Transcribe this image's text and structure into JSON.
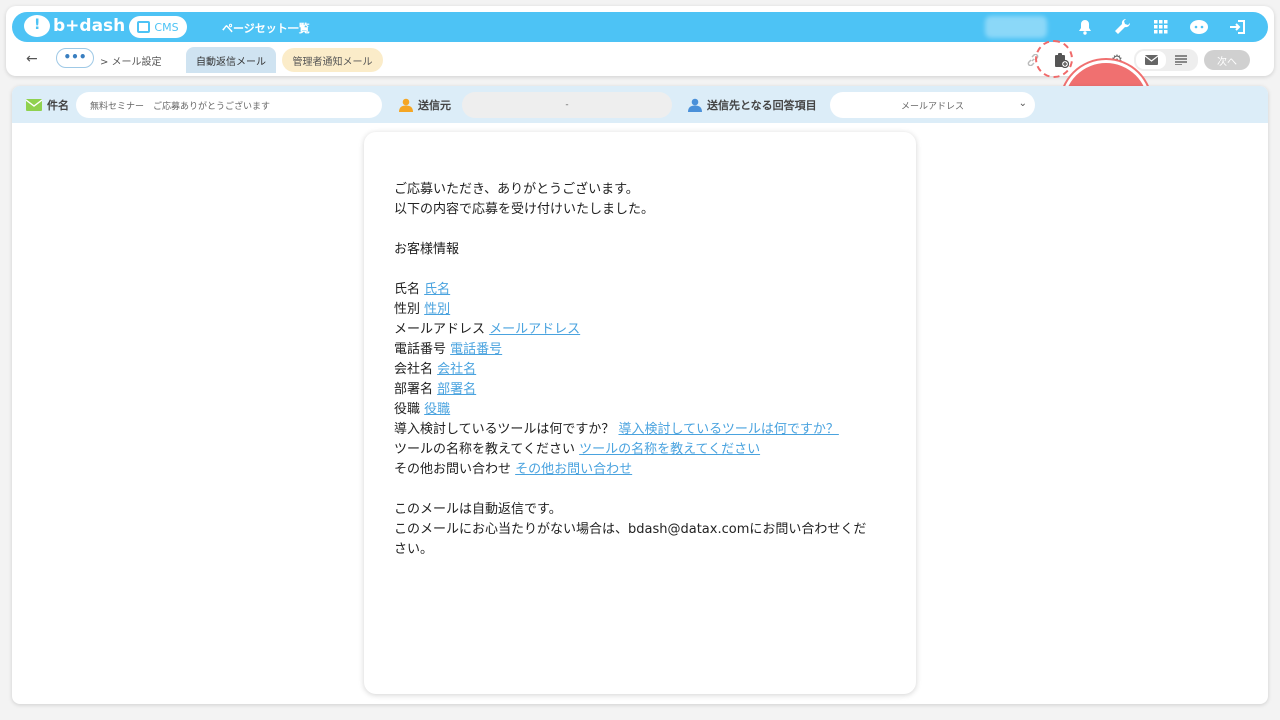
{
  "header": {
    "logo_text": "b+dash",
    "cms_label": "CMS",
    "page_title": "ページセット一覧",
    "brand_color": "#4dc3f5"
  },
  "subbar": {
    "dots_label": "•••",
    "breadcrumb": "> メール設定",
    "tabs": [
      {
        "label": "自動返信メール",
        "active": true
      },
      {
        "label": "管理者通知メール",
        "active": false
      }
    ],
    "next_label": "次へ"
  },
  "fields": {
    "subject_label": "件名",
    "subject_value": "無料セミナー　ご応募ありがとうございます",
    "sender_label": "送信元",
    "sender_value": "-",
    "recipient_label": "送信先となる回答項目",
    "recipient_value": "メールアドレス"
  },
  "mail": {
    "greeting_1": "ご応募いただき、ありがとうございます。",
    "greeting_2": "以下の内容で応募を受け付けいたしました。",
    "section": "お客様情報",
    "rows": [
      {
        "label": "氏名",
        "value": "氏名"
      },
      {
        "label": "性別",
        "value": "性別"
      },
      {
        "label": "メールアドレス",
        "value": "メールアドレス"
      },
      {
        "label": "電話番号",
        "value": "電話番号"
      },
      {
        "label": "会社名",
        "value": "会社名"
      },
      {
        "label": "部署名",
        "value": "部署名"
      },
      {
        "label": "役職",
        "value": "役職"
      },
      {
        "label": "導入検討しているツールは何ですか？",
        "value": "導入検討しているツールは何ですか？"
      },
      {
        "label": "ツールの名称を教えてください",
        "value": "ツールの名称を教えてください"
      },
      {
        "label": "その他お問い合わせ",
        "value": "その他お問い合わせ"
      }
    ],
    "footer_1": "このメールは自動返信です。",
    "footer_2": "このメールにお心当たりがない場合は、bdash@datax.comにお問い合わせくだ",
    "footer_3": "さい。"
  }
}
